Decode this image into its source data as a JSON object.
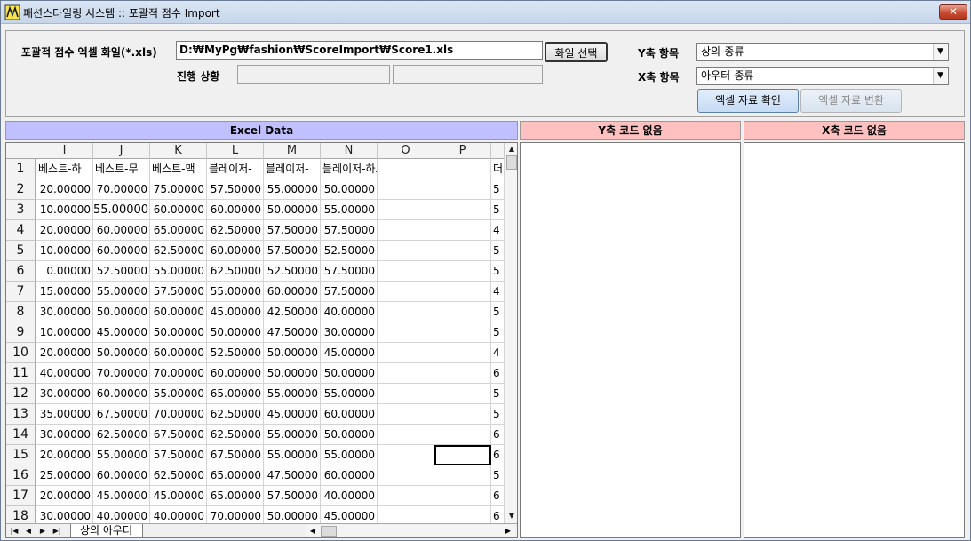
{
  "window": {
    "title": "패션스타일링 시스템 :: 포괄적 점수 Import",
    "close_label": "✕"
  },
  "form": {
    "file_label": "포괄적 점수 엑셀 화일(*.xls)",
    "file_value": "D:₩MyPg₩fashion₩ScoreImport₩Score1.xls",
    "file_select_button": "화일 선택",
    "progress_label": "진행 상황",
    "y_label": "Y축 항목",
    "y_value": "상의-종류",
    "x_label": "X축 항목",
    "x_value": "아우터-종류",
    "check_button": "엑셀 자료 확인",
    "convert_button": "엑셀 자료 변환"
  },
  "panels": {
    "excel_title": "Excel Data",
    "y_missing_title": "Y축 코드 없음",
    "x_missing_title": "X축 코드 없음",
    "colors": {
      "excel_head": "#c0c0ff",
      "missing_head": "#ffc0c0"
    }
  },
  "grid": {
    "columns": [
      "I",
      "J",
      "K",
      "L",
      "M",
      "N",
      "O",
      "P",
      ""
    ],
    "header_row": [
      "베스트-하",
      "베스트-무",
      "베스트-맥",
      "블레이저-",
      "블레이저-",
      "블레이저-하프",
      "",
      "",
      "더"
    ],
    "rows": [
      {
        "n": "2",
        "v": [
          "20.00000",
          "70.00000",
          "75.00000",
          "57.50000",
          "55.00000",
          "50.00000",
          "",
          "",
          "5"
        ]
      },
      {
        "n": "3",
        "v": [
          "10.00000",
          "55.00000",
          "60.00000",
          "60.00000",
          "50.00000",
          "55.00000",
          "",
          "",
          "5"
        ]
      },
      {
        "n": "4",
        "v": [
          "20.00000",
          "60.00000",
          "65.00000",
          "62.50000",
          "57.50000",
          "57.50000",
          "",
          "",
          "4"
        ]
      },
      {
        "n": "5",
        "v": [
          "10.00000",
          "60.00000",
          "62.50000",
          "60.00000",
          "57.50000",
          "52.50000",
          "",
          "",
          "5"
        ]
      },
      {
        "n": "6",
        "v": [
          "0.00000",
          "52.50000",
          "55.00000",
          "62.50000",
          "52.50000",
          "57.50000",
          "",
          "",
          "5"
        ]
      },
      {
        "n": "7",
        "v": [
          "15.00000",
          "55.00000",
          "57.50000",
          "55.00000",
          "60.00000",
          "57.50000",
          "",
          "",
          "4"
        ]
      },
      {
        "n": "8",
        "v": [
          "30.00000",
          "50.00000",
          "60.00000",
          "45.00000",
          "42.50000",
          "40.00000",
          "",
          "",
          "5"
        ]
      },
      {
        "n": "9",
        "v": [
          "10.00000",
          "45.00000",
          "50.00000",
          "50.00000",
          "47.50000",
          "30.00000",
          "",
          "",
          "5"
        ]
      },
      {
        "n": "10",
        "v": [
          "20.00000",
          "50.00000",
          "60.00000",
          "52.50000",
          "50.00000",
          "45.00000",
          "",
          "",
          "4"
        ]
      },
      {
        "n": "11",
        "v": [
          "40.00000",
          "70.00000",
          "70.00000",
          "60.00000",
          "50.00000",
          "50.00000",
          "",
          "",
          "6"
        ]
      },
      {
        "n": "12",
        "v": [
          "30.00000",
          "60.00000",
          "55.00000",
          "65.00000",
          "55.00000",
          "55.00000",
          "",
          "",
          "5"
        ]
      },
      {
        "n": "13",
        "v": [
          "35.00000",
          "67.50000",
          "70.00000",
          "62.50000",
          "45.00000",
          "60.00000",
          "",
          "",
          "5"
        ]
      },
      {
        "n": "14",
        "v": [
          "30.00000",
          "62.50000",
          "67.50000",
          "62.50000",
          "55.00000",
          "50.00000",
          "",
          "",
          "6"
        ]
      },
      {
        "n": "15",
        "v": [
          "20.00000",
          "55.00000",
          "57.50000",
          "67.50000",
          "55.00000",
          "55.00000",
          "",
          "",
          "6"
        ]
      },
      {
        "n": "16",
        "v": [
          "25.00000",
          "60.00000",
          "62.50000",
          "65.00000",
          "47.50000",
          "60.00000",
          "",
          "",
          "5"
        ]
      },
      {
        "n": "17",
        "v": [
          "20.00000",
          "45.00000",
          "45.00000",
          "65.00000",
          "57.50000",
          "40.00000",
          "",
          "",
          "6"
        ]
      },
      {
        "n": "18",
        "v": [
          "30.00000",
          "40.00000",
          "40.00000",
          "70.00000",
          "50.00000",
          "45.00000",
          "",
          "",
          "6"
        ]
      }
    ],
    "sheet_tab": "상의 아우터"
  }
}
